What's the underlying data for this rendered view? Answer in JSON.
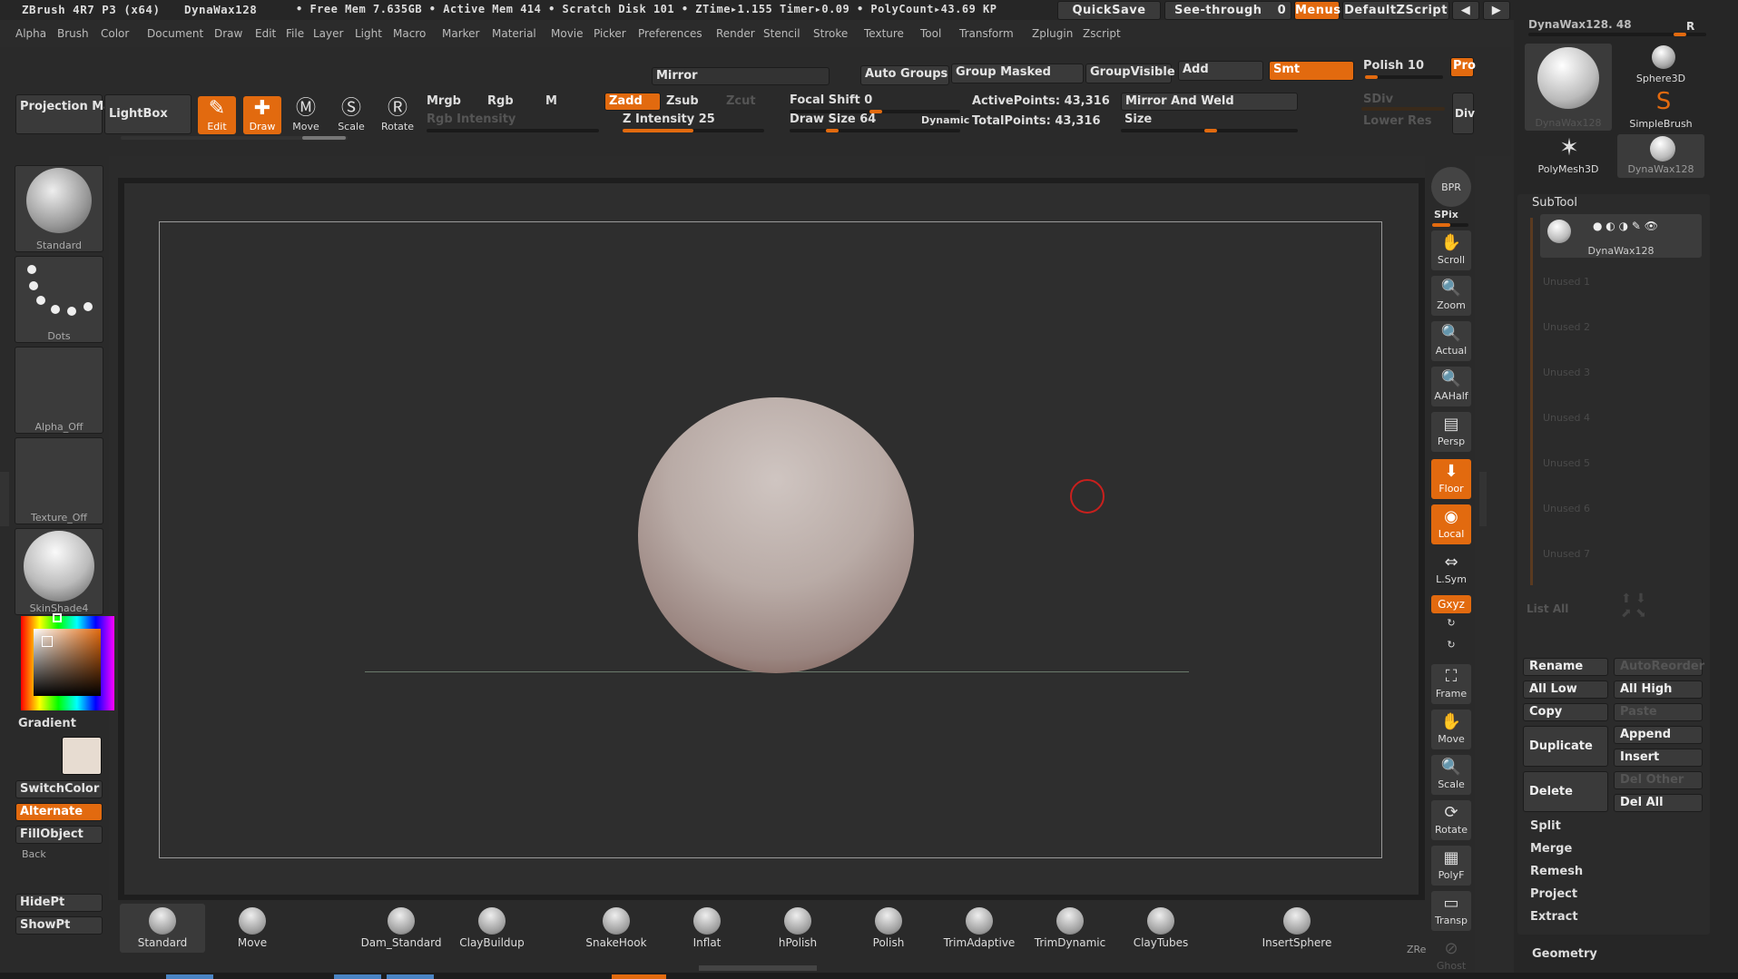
{
  "titlebar": {
    "app": "ZBrush 4R7 P3 (x64)",
    "doc": "DynaWax128",
    "stats": "• Free Mem 7.635GB • Active Mem 414 • Scratch Disk 101 • ZTime▸1.155 Timer▸0.09 • PolyCount▸43.69 KP",
    "quicksave": "QuickSave",
    "seethrough": "See-through",
    "seethrough_val": "0",
    "menus": "Menus",
    "zscript": "DefaultZScript"
  },
  "menubar": [
    "Alpha",
    "Brush",
    "Color",
    "Document",
    "Draw",
    "Edit",
    "File",
    "Layer",
    "Light",
    "Macro",
    "Marker",
    "Material",
    "Movie",
    "Picker",
    "Preferences",
    "Render",
    "Stencil",
    "Stroke",
    "Texture",
    "Tool",
    "Transform",
    "Zplugin",
    "Zscript"
  ],
  "shelf": {
    "mirror": "Mirror",
    "auto_groups": "Auto Groups",
    "group_masked": "Group Masked",
    "group_visible": "GroupVisible",
    "add": "Add",
    "smt": "Smt",
    "polish": "Polish",
    "polish_val": "10",
    "pro": "Pro",
    "projection_master": "Projection Master",
    "lightbox": "LightBox",
    "edit": "Edit",
    "draw": "Draw",
    "move": "Move",
    "scale": "Scale",
    "rotate": "Rotate",
    "mrgb": "Mrgb",
    "rgb": "Rgb",
    "m": "M",
    "zadd": "Zadd",
    "zsub": "Zsub",
    "zcut": "Zcut",
    "rgb_intensity": "Rgb Intensity",
    "z_intensity": "Z Intensity 25",
    "focal_shift": "Focal Shift 0",
    "draw_size": "Draw Size 64",
    "dynamic": "Dynamic",
    "active_points": "ActivePoints: 43,316",
    "total_points": "TotalPoints: 43,316",
    "mirror_weld": "Mirror And Weld",
    "size": "Size",
    "sdiv": "SDiv",
    "lower_res": "Lower Res",
    "div": "Div"
  },
  "left": {
    "brush": "Standard",
    "stroke": "Dots",
    "alpha": "Alpha_Off",
    "texture": "Texture_Off",
    "material": "SkinShade4",
    "gradient": "Gradient",
    "switch_color": "SwitchColor",
    "alternate": "Alternate",
    "fill_object": "FillObject",
    "back": "Back",
    "hide_pt": "HidePt",
    "show_pt": "ShowPt"
  },
  "right_shelf": [
    "BPR",
    "SPix",
    "Scroll",
    "Zoom",
    "Actual",
    "AAHalf",
    "Persp",
    "Floor",
    "Local",
    "L.Sym",
    "Gxyz",
    "Frame",
    "Move",
    "Scale",
    "Rotate",
    "PolyF",
    "Transp",
    "Ghost"
  ],
  "bottom_brushes": [
    "Standard",
    "Move",
    "Dam_Standard",
    "ClayBuildup",
    "SnakeHook",
    "Inflat",
    "hPolish",
    "Polish",
    "TrimAdaptive",
    "TrimDynamic",
    "ClayTubes",
    "InsertSphere"
  ],
  "bottom_extra": "ZRe",
  "tray": {
    "header": "DynaWax128. 48",
    "r": "R",
    "tools": [
      "DynaWax128",
      "Sphere3D",
      "SimpleBrush",
      "PolyMesh3D",
      "DynaWax128"
    ],
    "subtool_title": "SubTool",
    "subtool_active": "DynaWax128",
    "unused": [
      "Unused 1",
      "Unused 2",
      "Unused 3",
      "Unused 4",
      "Unused 5",
      "Unused 6",
      "Unused 7"
    ],
    "list_all": "List All",
    "rename": "Rename",
    "auto_reorder": "AutoReorder",
    "all_low": "All Low",
    "all_high": "All High",
    "copy": "Copy",
    "paste": "Paste",
    "duplicate": "Duplicate",
    "append": "Append",
    "insert": "Insert",
    "delete": "Delete",
    "del_other": "Del Other",
    "del_all": "Del All",
    "split": "Split",
    "merge": "Merge",
    "remesh": "Remesh",
    "project": "Project",
    "extract": "Extract",
    "geometry": "Geometry"
  },
  "colors": {
    "accent": "#e26a0f",
    "bg": "#2b2b2b",
    "canvas": "#2e2e2e",
    "cursor": "#c9201d"
  }
}
